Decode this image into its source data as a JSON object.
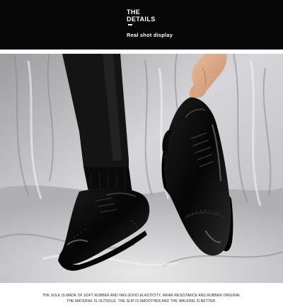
{
  "header": {
    "title_line1": "THE",
    "title_line2": "DETAILS",
    "subtitle": "Real shot display"
  },
  "photo": {
    "scene": "real-shot-photo",
    "shoe_color": "#0d0d0d",
    "background_color": "#d9d9db"
  },
  "caption": {
    "line1": "THE SOLE IS MADE OF SOFT RUBBER AND HAS GOOD ELASTICITY, WEAR RESISTANCE AND RUBBER ORIGINAL",
    "line2": "THE MATERIAL IS OUTSOLE. THE SLIP IS SMOOTHER AND THE WALKING IS BETTER."
  }
}
